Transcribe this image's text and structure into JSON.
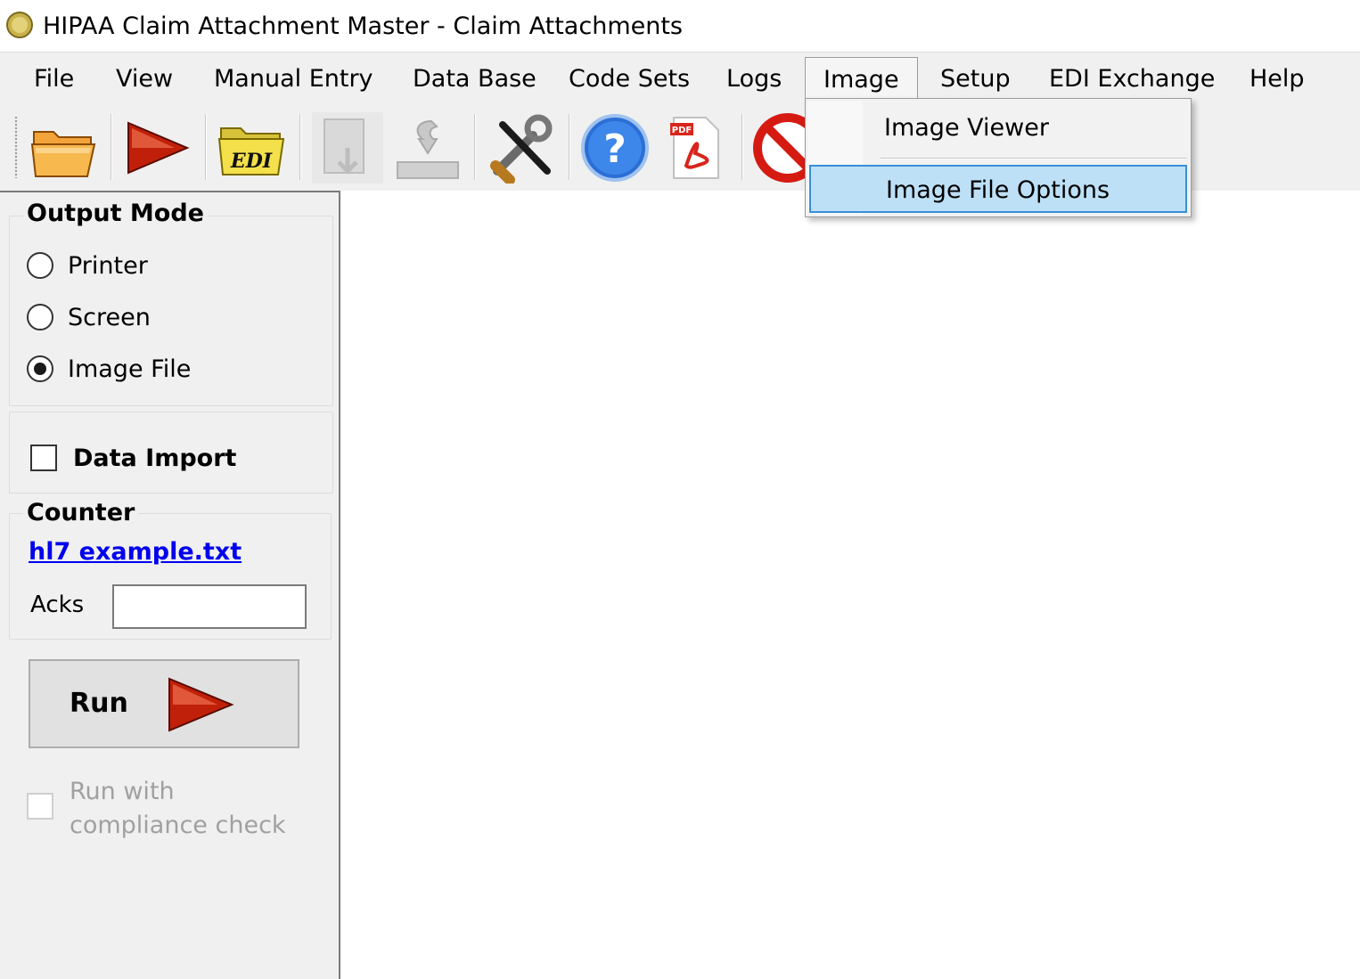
{
  "window": {
    "title": "HIPAA Claim Attachment Master - Claim Attachments",
    "app_icon": "app-coin-icon"
  },
  "menubar": {
    "items": [
      {
        "label": "File"
      },
      {
        "label": "View"
      },
      {
        "label": "Manual Entry"
      },
      {
        "label": "Data Base"
      },
      {
        "label": "Code Sets"
      },
      {
        "label": "Logs"
      },
      {
        "label": "Image"
      },
      {
        "label": "Setup"
      },
      {
        "label": "EDI Exchange"
      },
      {
        "label": "Help"
      }
    ],
    "open_menu": "Image"
  },
  "toolbar": {
    "buttons": [
      {
        "icon": "open-folder-icon",
        "enabled": true
      },
      {
        "icon": "run-arrow-icon",
        "enabled": true
      },
      {
        "icon": "edi-folder-icon",
        "label": "EDI",
        "enabled": true
      },
      {
        "icon": "download-icon",
        "enabled": false
      },
      {
        "icon": "import-icon",
        "enabled": false
      },
      {
        "icon": "tools-icon",
        "enabled": true
      },
      {
        "icon": "help-icon",
        "label": "?",
        "enabled": true
      },
      {
        "icon": "pdf-icon",
        "label": "PDF",
        "enabled": true
      },
      {
        "icon": "stop-icon",
        "enabled": true
      }
    ]
  },
  "dropdown": {
    "items": [
      {
        "label": "Image Viewer",
        "highlighted": false
      },
      {
        "label": "Image File Options",
        "highlighted": true
      }
    ]
  },
  "leftpanel": {
    "output_mode": {
      "title": "Output Mode",
      "options": [
        {
          "label": "Printer",
          "checked": false
        },
        {
          "label": "Screen",
          "checked": false
        },
        {
          "label": "Image File",
          "checked": true
        }
      ]
    },
    "data_import": {
      "label": "Data Import",
      "checked": false
    },
    "counter": {
      "title": "Counter",
      "file_link": "hl7 example.txt",
      "acks_label": "Acks",
      "acks_value": ""
    },
    "run_button": {
      "label": "Run"
    },
    "compliance": {
      "label_line1": "Run with",
      "label_line2": "compliance check",
      "checked": false,
      "enabled": false
    }
  },
  "colors": {
    "menu_highlight": "#bde0f7",
    "menu_highlight_border": "#3a8fd6",
    "link": "#0000ee",
    "run_arrow": "#c0200a"
  }
}
